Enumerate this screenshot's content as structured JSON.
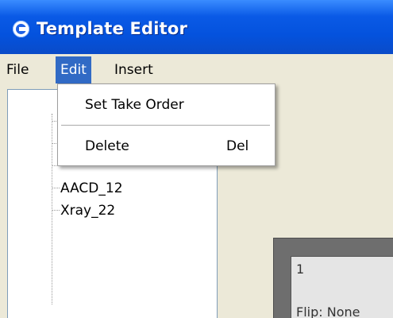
{
  "window": {
    "title": "Template Editor"
  },
  "menu": {
    "file": "File",
    "edit": "Edit",
    "insert": "Insert"
  },
  "edit_menu": {
    "items": [
      {
        "label": "Set Take Order",
        "shortcut": ""
      },
      {
        "label": "Delete",
        "shortcut": "Del"
      }
    ]
  },
  "tree": {
    "items": [
      {
        "label": ""
      },
      {
        "label": ""
      },
      {
        "label": ""
      },
      {
        "label": "AACD_12"
      },
      {
        "label": "Xray_22"
      }
    ]
  },
  "preview": {
    "number": "1",
    "flip": "Flip: None"
  },
  "colors": {
    "title_bar": "#0452dd",
    "menu_highlight": "#316ac5",
    "window_bg": "#ece9d8"
  }
}
